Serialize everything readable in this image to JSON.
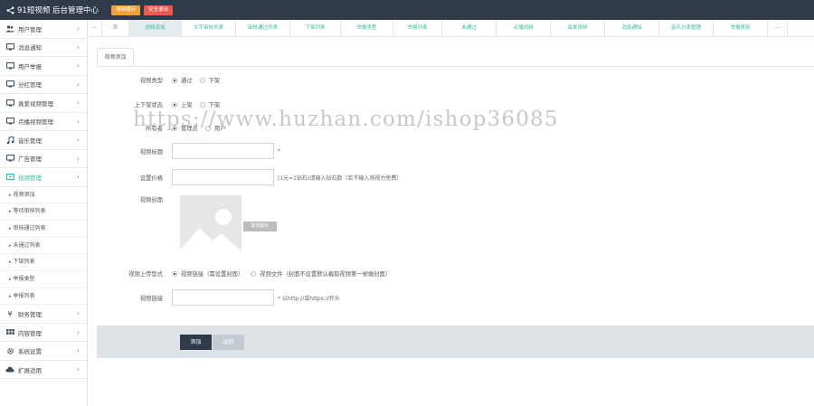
{
  "header": {
    "brand": "91短视频 后台管理中心",
    "btn_clear_cache": "清除缓存",
    "btn_logout": "安全退出"
  },
  "sidebar": {
    "menus": [
      {
        "label": "用户管理",
        "icon": "users-icon"
      },
      {
        "label": "消息通知",
        "icon": "monitor-icon"
      },
      {
        "label": "用户举报",
        "icon": "monitor-icon"
      },
      {
        "label": "分红管理",
        "icon": "monitor-icon"
      },
      {
        "label": "真爱视频管理",
        "icon": "monitor-icon"
      },
      {
        "label": "点播视频管理",
        "icon": "monitor-icon"
      },
      {
        "label": "音乐管理",
        "icon": "music-icon"
      },
      {
        "label": "广告管理",
        "icon": "monitor-icon"
      },
      {
        "label": "视频管理",
        "icon": "video-icon"
      }
    ],
    "video_submenu": [
      "视频添加",
      "等待审核列表",
      "审核通过列表",
      "未通过列表",
      "下架列表",
      "举报类型",
      "举报列表"
    ],
    "bottom_menus": [
      {
        "label": "财务管理",
        "icon": "yen-icon"
      },
      {
        "label": "内容管理",
        "icon": "grid-icon"
      },
      {
        "label": "系统设置",
        "icon": "gear-icon"
      },
      {
        "label": "扩展适用",
        "icon": "cloud-icon"
      }
    ]
  },
  "tabs": {
    "first": "—",
    "nav_prev": "首",
    "items": [
      "视频添加",
      "文字审核列表",
      "审核通过列表",
      "下架列表",
      "举报类型",
      "举报列表",
      "未通过",
      "点播视频",
      "真爱视频",
      "消息通知",
      "音乐分类管理",
      "举报类别"
    ],
    "nav_next": "—"
  },
  "subtab": "视频添加",
  "form": {
    "row1_label": "视频类型",
    "row1_opt_a": "通过",
    "row1_opt_b": "下架",
    "status_label": "上下架状态",
    "status_on": "上架",
    "status_off": "下架",
    "owner_label": "所有者",
    "owner_admin": "管理员",
    "owner_user": "用户",
    "title_label": "视频标题",
    "title_required": "*",
    "price_label": "设置价格",
    "price_hint": "(1元=1钻石)请输入钻石数（若不输入则视为免费）",
    "cover_label": "视频封面",
    "cover_button": "取消图片",
    "upload_label": "视频上传型式",
    "upload_link": "视频链接（需设置封面）",
    "upload_file": "视频文件（封面不设置默认截取视频第一帧做封面）",
    "link_label": "视频链接",
    "link_hint": "* 以http://或https://开头",
    "btn_add": "添加",
    "btn_back": "返回"
  },
  "watermark": "https://www.huzhan.com/ishop36085",
  "colors": {
    "topbar": "#2f3b4a",
    "accent_green": "#2dbd9b",
    "btn_orange": "#f0a13a",
    "btn_red": "#e55d4f"
  }
}
